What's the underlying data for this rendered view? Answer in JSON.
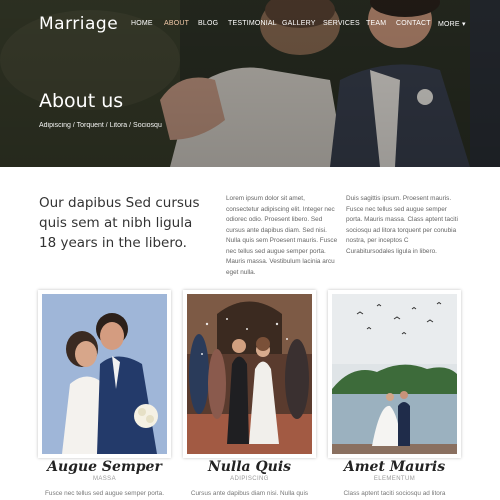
{
  "header": {
    "brand": "Marriage",
    "nav": [
      "HOME",
      "ABOUT",
      "BLOG",
      "TESTIMONIAL",
      "GALLERY",
      "SERVICES",
      "TEAM",
      "CONTACT",
      "MORE ▾"
    ]
  },
  "hero": {
    "title": "About us",
    "breadcrumb": "Adipiscing / Torquent / Litora / Sociosqu"
  },
  "intro": {
    "lead": "Our dapibus Sed cursus quis sem at nibh ligula 18 years in the libero.",
    "col1": "Lorem ipsum dolor sit amet, consectetur adipiscing elit. Integer nec odiorec odio. Proesent libero. Sed cursus ante dapibus diam. Sed nisi. Nulla quis sem Proesent mauris. Fusce nec tellus sed augue semper porta. Mauris massa. Vestibulum lacinia arcu eget nulla.",
    "col2": "Duis sagittis ipsum. Proesent mauris. Fusce nec tellus sed augue semper porta. Mauris massa. Class aptent taciti sociosqu ad litora torquent per conubia nostra, per inceptos C Curabitursodales ligula in libero."
  },
  "cards": [
    {
      "title": "Augue Semper",
      "subtitle": "MASSA",
      "text": "Fusce nec tellus sed augue semper porta."
    },
    {
      "title": "Nulla Quis",
      "subtitle": "ADIPISCING",
      "text": "Cursus ante dapibus diam nisi. Nulla quis"
    },
    {
      "title": "Amet Mauris",
      "subtitle": "ELEMENTUM",
      "text": "Class aptent taciti sociosqu ad litora"
    }
  ]
}
